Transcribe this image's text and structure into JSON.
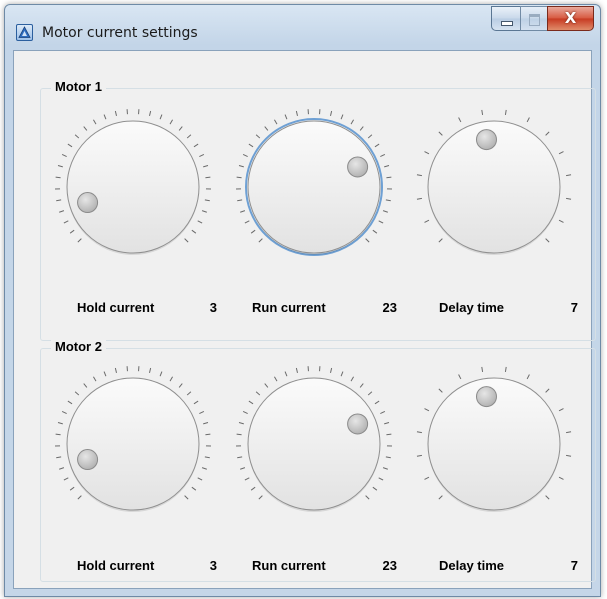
{
  "window": {
    "title": "Motor current settings",
    "icon": "app-icon",
    "caption_buttons": [
      "minimize-icon",
      "maximize-icon",
      "close-icon"
    ],
    "close_glyph": "X"
  },
  "colors": {
    "focus_ring": "#6ea0d4",
    "knob_face_top": "#fbfbfb",
    "knob_face_bottom": "#e2e2e2",
    "tick": "#6a6a6a",
    "group_border": "#d5dfe5",
    "close_button": "#c73a22"
  },
  "groups": [
    {
      "title": "Motor 1",
      "knobs": [
        {
          "label": "Hold current",
          "value": "3",
          "min": 0,
          "max": 31,
          "ticks": 32,
          "focused": false
        },
        {
          "label": "Run current",
          "value": "23",
          "min": 0,
          "max": 31,
          "ticks": 32,
          "focused": true
        },
        {
          "label": "Delay time",
          "value": "7",
          "min": 0,
          "max": 15,
          "ticks": 16,
          "focused": false
        }
      ]
    },
    {
      "title": "Motor 2",
      "knobs": [
        {
          "label": "Hold current",
          "value": "3",
          "min": 0,
          "max": 31,
          "ticks": 32,
          "focused": false
        },
        {
          "label": "Run current",
          "value": "23",
          "min": 0,
          "max": 31,
          "ticks": 32,
          "focused": false
        },
        {
          "label": "Delay time",
          "value": "7",
          "min": 0,
          "max": 15,
          "ticks": 16,
          "focused": false
        }
      ]
    }
  ]
}
